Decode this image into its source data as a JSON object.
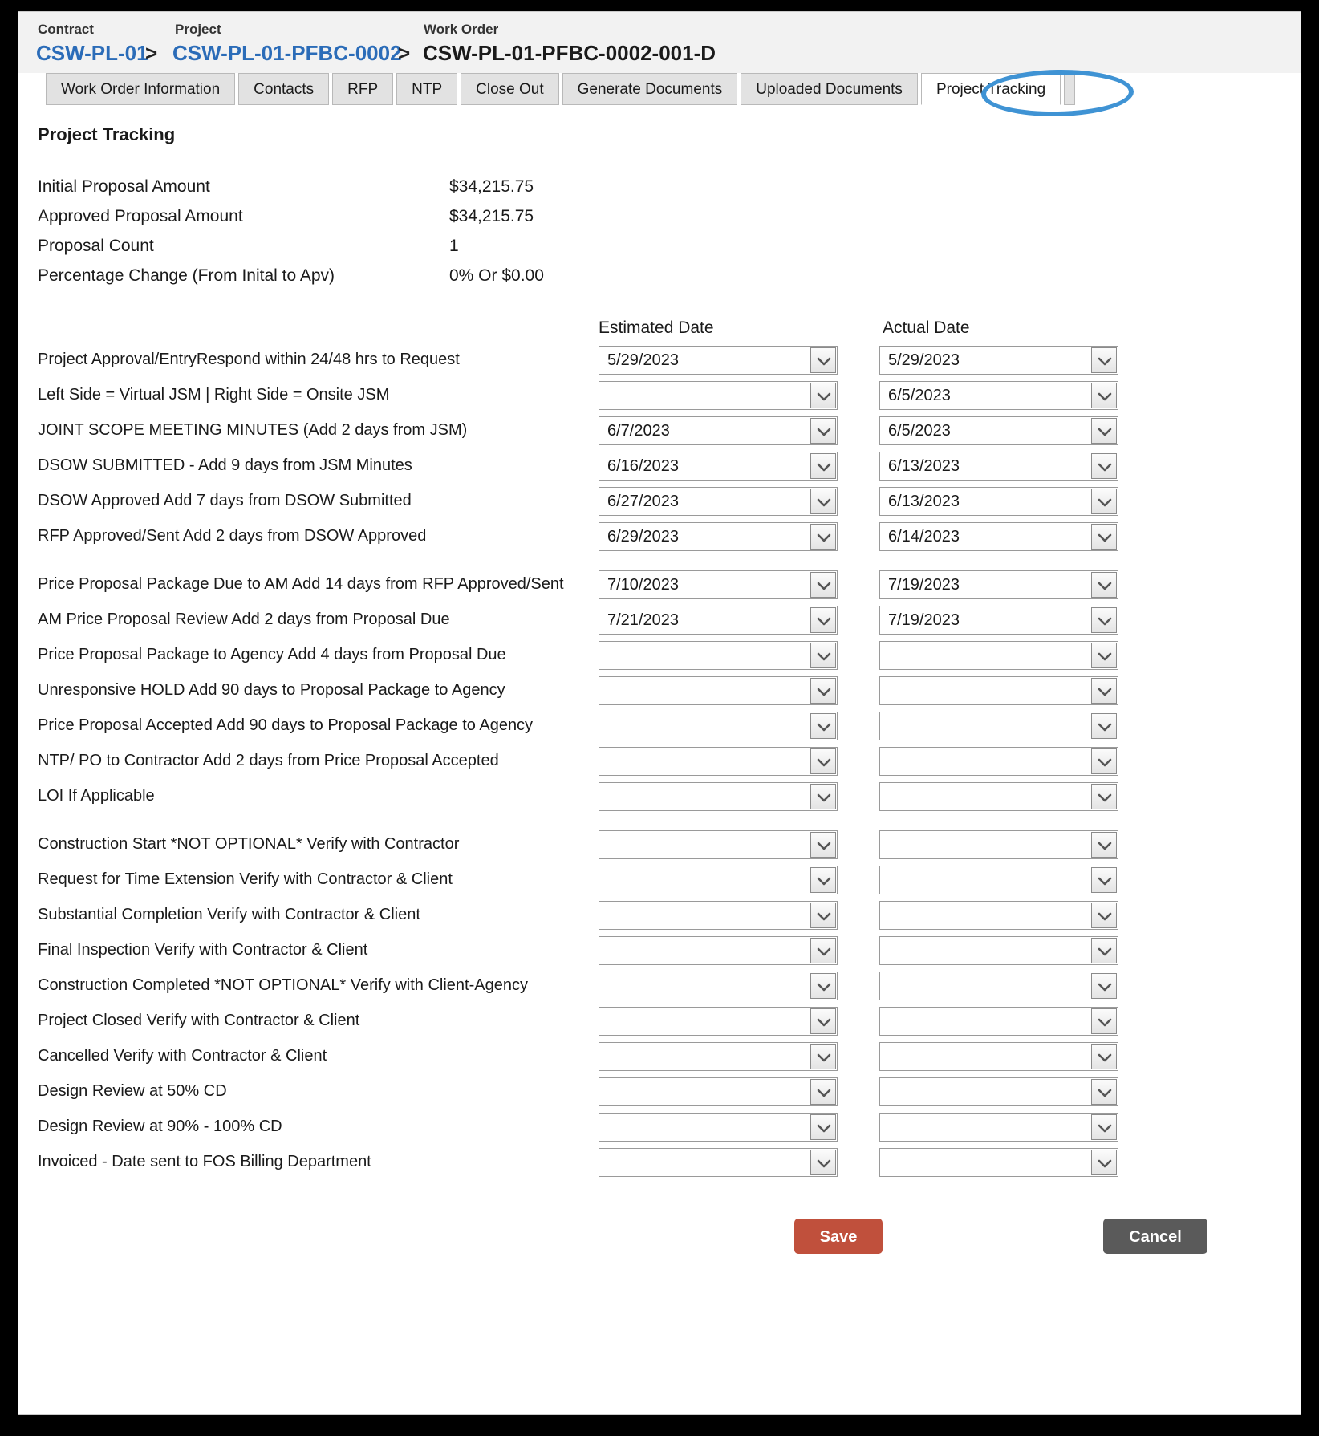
{
  "breadcrumb": {
    "contract_label": "Contract",
    "project_label": "Project",
    "work_order_label": "Work Order",
    "contract_value": "CSW-PL-01",
    "project_value": "CSW-PL-01-PFBC-0002",
    "work_order_value": "CSW-PL-01-PFBC-0002-001-D",
    "separator": ">"
  },
  "tabs": [
    {
      "label": "Work Order Information",
      "active": false
    },
    {
      "label": "Contacts",
      "active": false
    },
    {
      "label": "RFP",
      "active": false
    },
    {
      "label": "NTP",
      "active": false
    },
    {
      "label": "Close Out",
      "active": false
    },
    {
      "label": "Generate Documents",
      "active": false
    },
    {
      "label": "Uploaded Documents",
      "active": false
    },
    {
      "label": "Project Tracking",
      "active": true
    }
  ],
  "highlight_color": "#3f93d4",
  "page_title": "Project Tracking",
  "summary": [
    {
      "label": "Initial Proposal Amount",
      "value": "$34,215.75"
    },
    {
      "label": "Approved Proposal Amount",
      "value": "$34,215.75"
    },
    {
      "label": "Proposal Count",
      "value": "1"
    },
    {
      "label": "Percentage Change (From Inital to Apv)",
      "value": "0% Or $0.00"
    }
  ],
  "columns": {
    "estimated": "Estimated Date",
    "actual": "Actual Date"
  },
  "dropdown_icon": "chevron-down-icon",
  "rows": [
    {
      "label": "Project Approval/EntryRespond within 24/48 hrs to Request",
      "estimated": "5/29/2023",
      "actual": "5/29/2023",
      "gap": false
    },
    {
      "label": "Left Side = Virtual JSM | Right Side = Onsite JSM",
      "estimated": "",
      "actual": "6/5/2023",
      "gap": false
    },
    {
      "label": "JOINT SCOPE MEETING MINUTES (Add 2 days from JSM)",
      "estimated": "6/7/2023",
      "actual": "6/5/2023",
      "gap": false
    },
    {
      "label": "DSOW SUBMITTED - Add 9 days from JSM Minutes",
      "estimated": "6/16/2023",
      "actual": "6/13/2023",
      "gap": false
    },
    {
      "label": "DSOW Approved Add 7 days from DSOW Submitted",
      "estimated": "6/27/2023",
      "actual": "6/13/2023",
      "gap": false
    },
    {
      "label": "RFP Approved/Sent Add 2 days from DSOW Approved",
      "estimated": "6/29/2023",
      "actual": "6/14/2023",
      "gap": false
    },
    {
      "label": "Price Proposal Package Due to AM Add 14 days from RFP Approved/Sent",
      "estimated": "7/10/2023",
      "actual": "7/19/2023",
      "gap": true
    },
    {
      "label": "AM Price Proposal Review Add 2 days from Proposal Due",
      "estimated": "7/21/2023",
      "actual": "7/19/2023",
      "gap": false
    },
    {
      "label": "Price Proposal Package to Agency Add 4 days from Proposal Due",
      "estimated": "",
      "actual": "",
      "gap": false
    },
    {
      "label": "Unresponsive HOLD Add 90 days to Proposal Package to Agency",
      "estimated": "",
      "actual": "",
      "gap": false
    },
    {
      "label": "Price Proposal Accepted Add 90 days to Proposal Package to Agency",
      "estimated": "",
      "actual": "",
      "gap": false
    },
    {
      "label": "NTP/ PO to Contractor Add 2 days from Price Proposal Accepted",
      "estimated": "",
      "actual": "",
      "gap": false
    },
    {
      "label": "LOI If Applicable",
      "estimated": "",
      "actual": "",
      "gap": false
    },
    {
      "label": "Construction Start *NOT OPTIONAL* Verify with Contractor",
      "estimated": "",
      "actual": "",
      "gap": true
    },
    {
      "label": "Request for Time Extension Verify with Contractor & Client",
      "estimated": "",
      "actual": "",
      "gap": false
    },
    {
      "label": "Substantial Completion Verify with Contractor & Client",
      "estimated": "",
      "actual": "",
      "gap": false
    },
    {
      "label": "Final Inspection Verify with Contractor & Client",
      "estimated": "",
      "actual": "",
      "gap": false
    },
    {
      "label": "Construction Completed *NOT OPTIONAL* Verify with Client-Agency",
      "estimated": "",
      "actual": "",
      "gap": false
    },
    {
      "label": "Project Closed Verify with Contractor & Client",
      "estimated": "",
      "actual": "",
      "gap": false
    },
    {
      "label": "Cancelled Verify with Contractor & Client",
      "estimated": "",
      "actual": "",
      "gap": false
    },
    {
      "label": "Design Review at 50% CD",
      "estimated": "",
      "actual": "",
      "gap": false
    },
    {
      "label": "Design Review at 90% - 100% CD",
      "estimated": "",
      "actual": "",
      "gap": false
    },
    {
      "label": "Invoiced - Date sent to FOS Billing Department",
      "estimated": "",
      "actual": "",
      "gap": false
    }
  ],
  "footer": {
    "save_label": "Save",
    "cancel_label": "Cancel",
    "save_color": "#c0503c",
    "cancel_color": "#5a5a5a"
  }
}
